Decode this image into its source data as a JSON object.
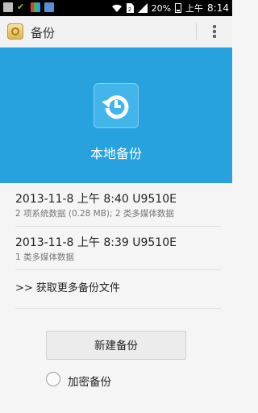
{
  "status_bar": {
    "battery": "20%",
    "time_period": "上午",
    "time": "8:14",
    "left_icons": [
      "image-icon",
      "check-icon",
      "app-icon",
      "photo-icon"
    ],
    "right_icons": [
      "wifi-icon",
      "sim-icon",
      "signal-icon",
      "battery-icon"
    ]
  },
  "action_bar": {
    "title": "备份"
  },
  "hero": {
    "label": "本地备份",
    "icon": "restore-icon"
  },
  "backups": [
    {
      "title": "2013-11-8 上午 8:40 U9510E",
      "detail": "2 项系统数据 (0.28 MB); 2 类多媒体数据"
    },
    {
      "title": "2013-11-8 上午 8:39 U9510E",
      "detail": "1 类多媒体数据"
    }
  ],
  "more_link": ">> 获取更多备份文件",
  "new_backup_button": "新建备份",
  "encrypt_option": {
    "label": "加密备份",
    "checked": false
  },
  "colors": {
    "hero": "#27a2de",
    "status_bar": "#000000"
  }
}
